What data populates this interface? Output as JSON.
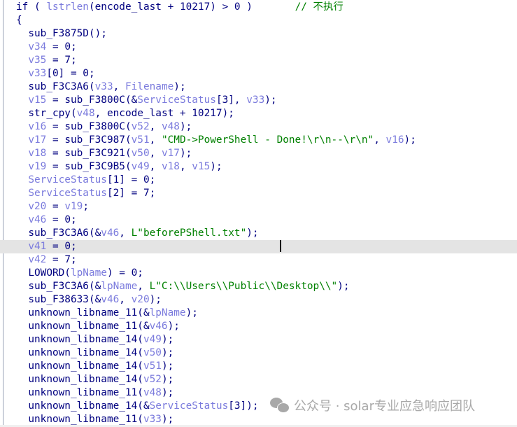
{
  "editor": {
    "highlighted_line": 18,
    "lines": [
      [
        [
          "kw",
          "if ( "
        ],
        [
          "var",
          "lstrlen"
        ],
        [
          "txt",
          "(encode_last + 10217) > 0 )       "
        ],
        [
          "cmt",
          "// 不执行"
        ]
      ],
      [
        [
          "txt",
          "{"
        ]
      ],
      [
        [
          "txt",
          "  sub_F3875D();"
        ]
      ],
      [
        [
          "txt",
          "  "
        ],
        [
          "var",
          "v34"
        ],
        [
          "txt",
          " = 0;"
        ]
      ],
      [
        [
          "txt",
          "  "
        ],
        [
          "var",
          "v35"
        ],
        [
          "txt",
          " = 7;"
        ]
      ],
      [
        [
          "txt",
          "  "
        ],
        [
          "var",
          "v33"
        ],
        [
          "txt",
          "[0] = 0;"
        ]
      ],
      [
        [
          "txt",
          "  sub_F3C3A6("
        ],
        [
          "var",
          "v33"
        ],
        [
          "txt",
          ", "
        ],
        [
          "var",
          "Filename"
        ],
        [
          "txt",
          ");"
        ]
      ],
      [
        [
          "txt",
          "  "
        ],
        [
          "var",
          "v15"
        ],
        [
          "txt",
          " = sub_F3800C(&"
        ],
        [
          "var",
          "ServiceStatus"
        ],
        [
          "txt",
          "[3], "
        ],
        [
          "var",
          "v33"
        ],
        [
          "txt",
          ");"
        ]
      ],
      [
        [
          "txt",
          "  str_cpy("
        ],
        [
          "var",
          "v48"
        ],
        [
          "txt",
          ", encode_last + 10217);"
        ]
      ],
      [
        [
          "txt",
          "  "
        ],
        [
          "var",
          "v16"
        ],
        [
          "txt",
          " = sub_F3800C("
        ],
        [
          "var",
          "v52"
        ],
        [
          "txt",
          ", "
        ],
        [
          "var",
          "v48"
        ],
        [
          "txt",
          ");"
        ]
      ],
      [
        [
          "txt",
          "  "
        ],
        [
          "var",
          "v17"
        ],
        [
          "txt",
          " = sub_F3C987("
        ],
        [
          "var",
          "v51"
        ],
        [
          "txt",
          ", "
        ],
        [
          "str",
          "\"CMD->PowerShell - Done!\\r\\n--\\r\\n\""
        ],
        [
          "txt",
          ", "
        ],
        [
          "var",
          "v16"
        ],
        [
          "txt",
          ");"
        ]
      ],
      [
        [
          "txt",
          "  "
        ],
        [
          "var",
          "v18"
        ],
        [
          "txt",
          " = sub_F3C921("
        ],
        [
          "var",
          "v50"
        ],
        [
          "txt",
          ", "
        ],
        [
          "var",
          "v17"
        ],
        [
          "txt",
          ");"
        ]
      ],
      [
        [
          "txt",
          "  "
        ],
        [
          "var",
          "v19"
        ],
        [
          "txt",
          " = sub_F3C9B5("
        ],
        [
          "var",
          "v49"
        ],
        [
          "txt",
          ", "
        ],
        [
          "var",
          "v18"
        ],
        [
          "txt",
          ", "
        ],
        [
          "var",
          "v15"
        ],
        [
          "txt",
          ");"
        ]
      ],
      [
        [
          "txt",
          "  "
        ],
        [
          "var",
          "ServiceStatus"
        ],
        [
          "txt",
          "[1] = 0;"
        ]
      ],
      [
        [
          "txt",
          "  "
        ],
        [
          "var",
          "ServiceStatus"
        ],
        [
          "txt",
          "[2] = 7;"
        ]
      ],
      [
        [
          "txt",
          "  "
        ],
        [
          "var",
          "v20"
        ],
        [
          "txt",
          " = "
        ],
        [
          "var",
          "v19"
        ],
        [
          "txt",
          ";"
        ]
      ],
      [
        [
          "txt",
          "  "
        ],
        [
          "var",
          "v46"
        ],
        [
          "txt",
          " = 0;"
        ]
      ],
      [
        [
          "txt",
          "  sub_F3C3A6(&"
        ],
        [
          "var",
          "v46"
        ],
        [
          "txt",
          ", "
        ],
        [
          "str",
          "L\"beforePShell.txt\""
        ],
        [
          "txt",
          ");"
        ]
      ],
      [
        [
          "txt",
          "  "
        ],
        [
          "var",
          "v41"
        ],
        [
          "txt",
          " = 0;"
        ]
      ],
      [
        [
          "txt",
          "  "
        ],
        [
          "var",
          "v42"
        ],
        [
          "txt",
          " = 7;"
        ]
      ],
      [
        [
          "txt",
          "  LOWORD("
        ],
        [
          "var",
          "lpName"
        ],
        [
          "txt",
          ") = 0;"
        ]
      ],
      [
        [
          "txt",
          "  sub_F3C3A6(&"
        ],
        [
          "var",
          "lpName"
        ],
        [
          "txt",
          ", "
        ],
        [
          "str",
          "L\"C:\\\\Users\\\\Public\\\\Desktop\\\\\""
        ],
        [
          "txt",
          ");"
        ]
      ],
      [
        [
          "txt",
          "  sub_F38633(&"
        ],
        [
          "var",
          "v46"
        ],
        [
          "txt",
          ", "
        ],
        [
          "var",
          "v20"
        ],
        [
          "txt",
          ");"
        ]
      ],
      [
        [
          "txt",
          "  unknown_libname_11(&"
        ],
        [
          "var",
          "lpName"
        ],
        [
          "txt",
          ");"
        ]
      ],
      [
        [
          "txt",
          "  unknown_libname_11(&"
        ],
        [
          "var",
          "v46"
        ],
        [
          "txt",
          ");"
        ]
      ],
      [
        [
          "txt",
          "  unknown_libname_14("
        ],
        [
          "var",
          "v49"
        ],
        [
          "txt",
          ");"
        ]
      ],
      [
        [
          "txt",
          "  unknown_libname_14("
        ],
        [
          "var",
          "v50"
        ],
        [
          "txt",
          ");"
        ]
      ],
      [
        [
          "txt",
          "  unknown_libname_14("
        ],
        [
          "var",
          "v51"
        ],
        [
          "txt",
          ");"
        ]
      ],
      [
        [
          "txt",
          "  unknown_libname_14("
        ],
        [
          "var",
          "v52"
        ],
        [
          "txt",
          ");"
        ]
      ],
      [
        [
          "txt",
          "  unknown_libname_11("
        ],
        [
          "var",
          "v48"
        ],
        [
          "txt",
          ");"
        ]
      ],
      [
        [
          "txt",
          "  unknown_libname_14(&"
        ],
        [
          "var",
          "ServiceStatus"
        ],
        [
          "txt",
          "[3]);"
        ]
      ],
      [
        [
          "txt",
          "  unknown_libname_11("
        ],
        [
          "var",
          "v33"
        ],
        [
          "txt",
          ");"
        ]
      ]
    ]
  },
  "colors": {
    "keyword": "#000080",
    "variable": "#7b7bdd",
    "string": "#008000",
    "comment": "#008000",
    "highlight_row": "#e4e4e4"
  },
  "watermark": {
    "icon": "wechat-icon",
    "text": "公众号 · solar专业应急响应团队"
  }
}
